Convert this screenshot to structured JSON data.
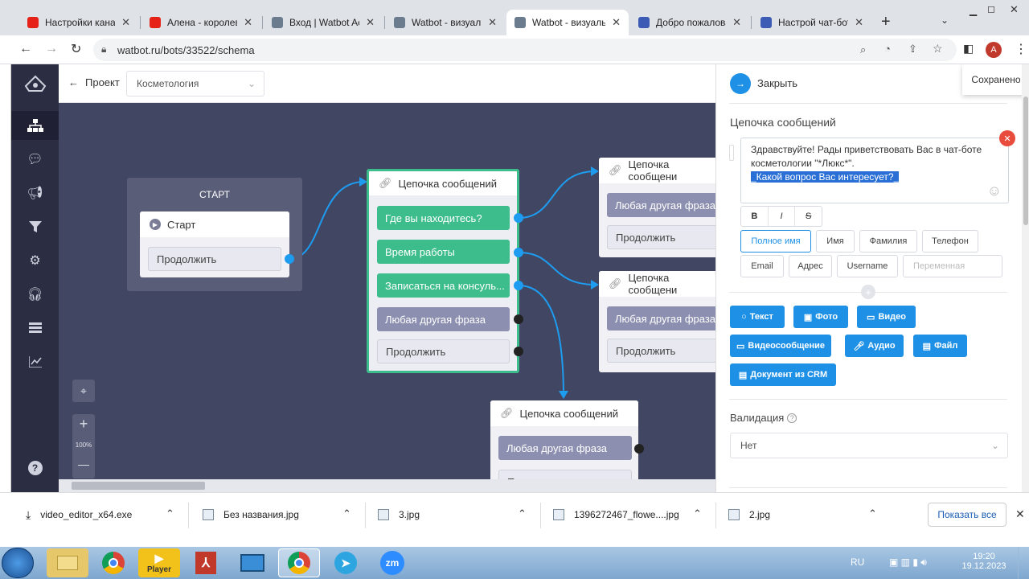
{
  "browser": {
    "tabs": [
      {
        "title": "Настройки канал",
        "color": "#e62117"
      },
      {
        "title": "Алена - королева",
        "color": "#e62117"
      },
      {
        "title": "Вход | Watbot Ac",
        "color": "#6b7c8f"
      },
      {
        "title": "Watbot - визуаль",
        "color": "#6b7c8f"
      },
      {
        "title": "Watbot - визуаль",
        "color": "#6b7c8f",
        "active": true
      },
      {
        "title": "Добро пожалова",
        "color": "#3b5bb5"
      },
      {
        "title": "Настрой чат-бот",
        "color": "#3b5bb5"
      }
    ],
    "new_tab": "+",
    "url": "watbot.ru/bots/33522/schema",
    "avatar_letter": "A"
  },
  "topbar": {
    "back_label": "Проект",
    "project_select": "Косметология"
  },
  "canvas": {
    "start_group_title": "СТАРТ",
    "start_node": {
      "title": "Старт",
      "button": "Продолжить"
    },
    "main_node": {
      "title": "Цепочка сообщений",
      "buttons": [
        "Где вы находитесь?",
        "Время работы",
        "Записаться на консуль...",
        "Любая другая фраза",
        "Продолжить"
      ]
    },
    "node_right_top": {
      "title": "Цепочка сообщени",
      "buttons": [
        "Любая другая фраза",
        "Продолжить"
      ]
    },
    "node_right_mid": {
      "title": "Цепочка сообщени",
      "buttons": [
        "Любая другая фраза",
        "Продолжить"
      ]
    },
    "node_bottom": {
      "title": "Цепочка сообщений",
      "buttons": [
        "Любая другая фраза",
        "Продолжить"
      ]
    },
    "zoom_label": "100%",
    "zoom_in": "+",
    "zoom_out": "—"
  },
  "panel": {
    "close_label": "Закрыть",
    "saved_label": "Сохранено",
    "section_title": "Цепочка сообщений",
    "message_line1": "Здравствуйте! Рады приветствовать Вас в чат-боте",
    "message_line2": "косметологии \"*Люкс*\".",
    "message_line3": "_Какой вопрос Вас интересует?_",
    "format_buttons": [
      "B",
      "I",
      "S"
    ],
    "variables": [
      "Полное имя",
      "Имя",
      "Фамилия",
      "Телефон",
      "Email",
      "Адрес",
      "Username"
    ],
    "variable_placeholder": "Переменная",
    "add_buttons_row1": [
      "Текст",
      "Фото",
      "Видео"
    ],
    "add_buttons_row2": [
      "Видеосообщение",
      "Аудио",
      "Файл"
    ],
    "add_buttons_row3": [
      "Документ из CRM"
    ],
    "validation_label": "Валидация",
    "validation_value": "Нет"
  },
  "downloads": {
    "items": [
      "video_editor_x64.exe",
      "Без названия.jpg",
      "3.jpg",
      "1396272467_flowe....jpg",
      "2.jpg"
    ],
    "show_all": "Показать все"
  },
  "taskbar": {
    "lang": "RU",
    "time": "19:20",
    "date": "19.12.2023",
    "apps": [
      "Player",
      "zm"
    ]
  }
}
